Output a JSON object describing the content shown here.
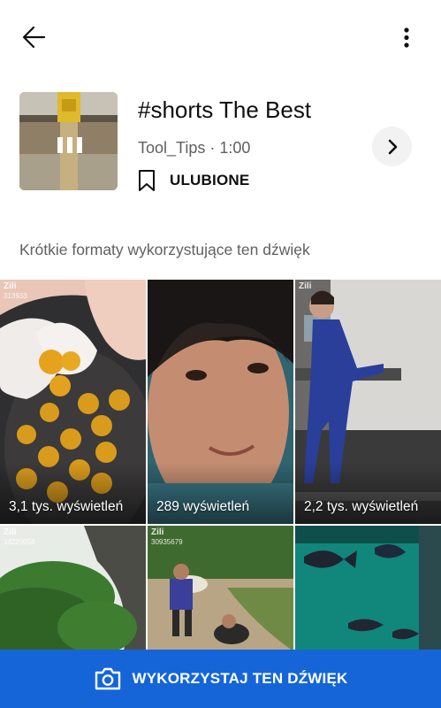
{
  "sound": {
    "title": "#shorts The Best",
    "meta": "Tool_Tips · 1:00",
    "favorite_label": "ULUBIONE"
  },
  "section_label": "Krótkie formaty wykorzystujące ten dźwięk",
  "shorts": [
    {
      "views": "3,1 tys. wyświetleń",
      "watermark": "Zili",
      "watermark_id": "313933"
    },
    {
      "views": "289 wyświetleń",
      "watermark": "",
      "watermark_id": ""
    },
    {
      "views": "2,2 tys. wyświetleń",
      "watermark": "Zili",
      "watermark_id": ""
    },
    {
      "views": "",
      "watermark": "Zili",
      "watermark_id": "14220058"
    },
    {
      "views": "",
      "watermark": "Zili",
      "watermark_id": "30935679"
    },
    {
      "views": "",
      "watermark": "",
      "watermark_id": ""
    }
  ],
  "cta": {
    "label": "WYKORZYSTAJ TEN DŹWIĘK"
  },
  "icons": {
    "back": "arrow-left-icon",
    "more": "more-vert-icon",
    "next": "chevron-right-icon",
    "favorite": "bookmark-icon",
    "cta": "camera-icon",
    "thumb": "pause-icon"
  },
  "colors": {
    "accent": "#1565d8",
    "secondary_text": "#606060"
  }
}
